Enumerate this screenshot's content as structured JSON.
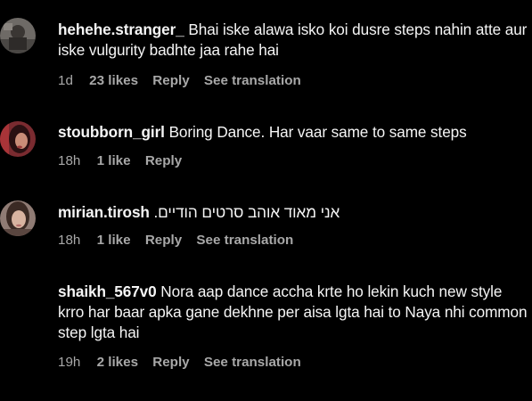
{
  "comments": [
    {
      "username": "hehehe.stranger_",
      "text": "Bhai iske alawa isko koi dusre steps nahin atte aur iske vulgurity badhte jaa rahe hai",
      "time": "1d",
      "likes": "23 likes",
      "reply": "Reply",
      "translation": "See translation"
    },
    {
      "username": "stoubborn_girl",
      "text": "Boring Dance. Har vaar same to same steps",
      "time": "18h",
      "likes": "1 like",
      "reply": "Reply"
    },
    {
      "username": "mirian.tirosh",
      "text": "אני מאוד אוהב סרטים הודיים.",
      "time": "18h",
      "likes": "1 like",
      "reply": "Reply",
      "translation": "See translation"
    },
    {
      "username": "shaikh_567v0",
      "text": "Nora aap dance accha krte ho lekin kuch new style krro har baar apka gane dekhne per aisa lgta hai to Naya nhi common step lgta hai",
      "time": "19h",
      "likes": "2 likes",
      "reply": "Reply",
      "translation": "See translation"
    }
  ]
}
